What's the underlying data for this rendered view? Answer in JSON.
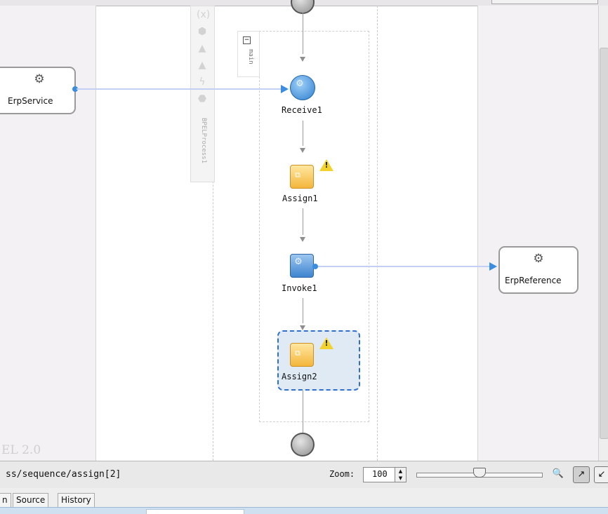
{
  "canvas": {
    "palette_label": "BPELProcess1",
    "scope_label": "main",
    "watermark": "EL 2.0",
    "services": {
      "left_label": "ErpService",
      "right_label": "ErpReference"
    },
    "activities": [
      {
        "name": "Receive1",
        "kind": "receive"
      },
      {
        "name": "Assign1",
        "kind": "assign",
        "warning": true
      },
      {
        "name": "Invoke1",
        "kind": "invoke"
      },
      {
        "name": "Assign2",
        "kind": "assign",
        "warning": true,
        "selected": true
      }
    ]
  },
  "statusbar": {
    "xpath": "ss/sequence/assign[2]",
    "zoom_label": "Zoom:",
    "zoom_value": "100",
    "zoom_slider_value": 100
  },
  "tabs": [
    {
      "label": "n"
    },
    {
      "label": "Source"
    },
    {
      "label": "History"
    }
  ],
  "icons": {
    "palette": [
      "variable-icon",
      "partner-link-icon",
      "warning-icon",
      "warning-icon",
      "event-icon",
      "correlation-icon"
    ],
    "service": "gear-icon",
    "warning": "warning-icon",
    "tools": [
      "zoom-in-icon",
      "select-arrow-icon",
      "pan-icon"
    ]
  },
  "colors": {
    "lane_bg": "#f4f1f4",
    "connector": "#3b8de0",
    "assign_fill": "#f4b63c",
    "invoke_fill": "#3f85cf",
    "selection": "#2f6fd0"
  }
}
